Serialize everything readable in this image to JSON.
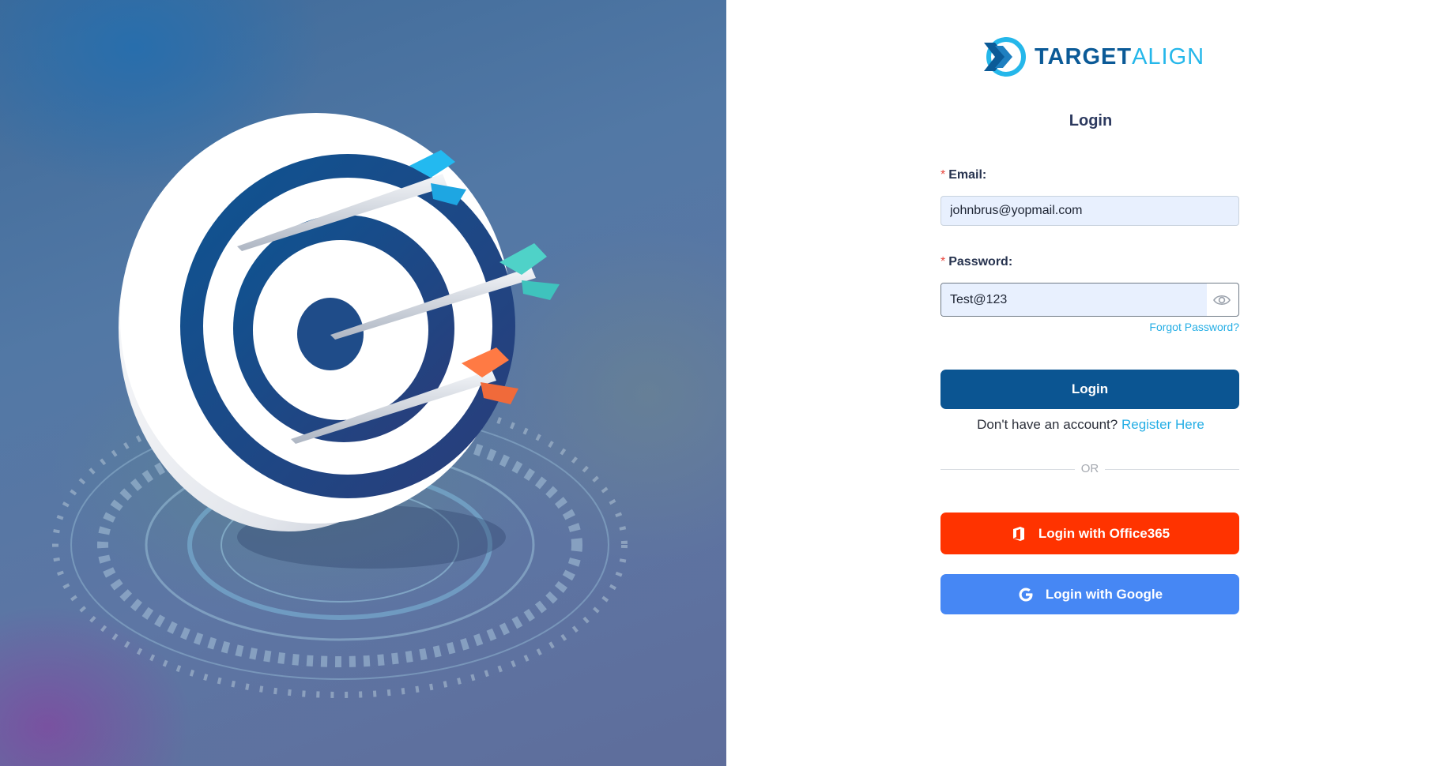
{
  "brand": {
    "name_part1": "TARGET",
    "name_part2": "ALIGN",
    "primary_color": "#0b5a97",
    "accent_color": "#25b7ea"
  },
  "login_form": {
    "title": "Login",
    "email_label": "Email:",
    "email_value": "johnbrus@yopmail.com",
    "password_label": "Password:",
    "password_value": "Test@123",
    "required_marker": "*",
    "forgot_password": "Forgot Password?",
    "login_button": "Login",
    "register_prompt": "Don't have an account?",
    "register_link": "Register Here",
    "divider_text": "OR",
    "office365_button": "Login with Office365",
    "google_button": "Login with Google"
  },
  "icons": {
    "brand_logo": "targetalign-chevron-logo",
    "password_toggle": "eye-icon",
    "office365": "office365-icon",
    "google": "google-icon",
    "hero": "target-with-arrows-illustration"
  },
  "colors": {
    "login_button": "#0b5592",
    "office365_button": "#ff3300",
    "google_button": "#4687f4",
    "link": "#25aee5"
  }
}
